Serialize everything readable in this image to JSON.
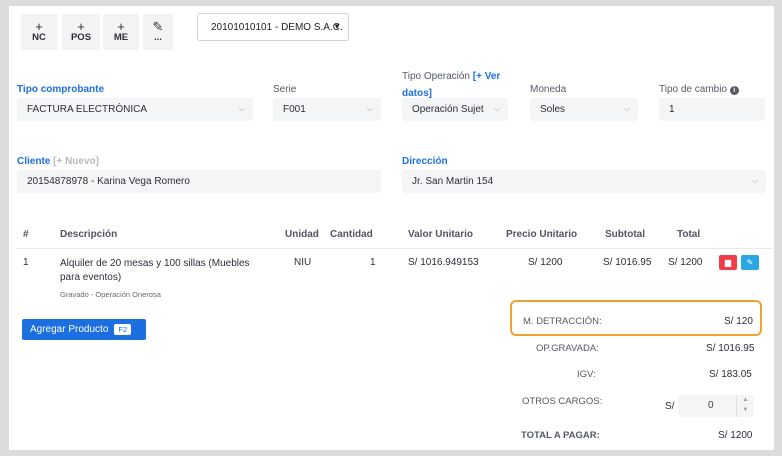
{
  "toolbar": {
    "buttons": [
      {
        "icon": "plus-icon",
        "glyph": "+",
        "label": "NC"
      },
      {
        "icon": "plus-icon",
        "glyph": "+",
        "label": "POS"
      },
      {
        "icon": "plus-icon",
        "glyph": "+",
        "label": "ME"
      },
      {
        "icon": "pencil-icon",
        "glyph": "✎",
        "label": "..."
      }
    ],
    "company": "20101010101 - DEMO S.A.C."
  },
  "form": {
    "tipo_comprobante": {
      "label": "Tipo comprobante",
      "value": "FACTURA ELECTRÓNICA"
    },
    "serie": {
      "label": "Serie",
      "value": "F001"
    },
    "tipo_operacion": {
      "label": "Tipo Operación",
      "link": "[+ Ver datos]",
      "value": "Operación Sujet"
    },
    "moneda": {
      "label": "Moneda",
      "value": "Soles"
    },
    "tipo_cambio": {
      "label": "Tipo de cambio",
      "value": "1"
    },
    "cliente": {
      "label": "Cliente",
      "link": "[+ Nuevo]",
      "value": "20154878978 - Karina Vega Romero"
    },
    "direccion": {
      "label": "Dirección",
      "value": "Jr. San Martin 154"
    }
  },
  "table": {
    "headers": [
      "#",
      "Descripción",
      "Unidad",
      "Cantidad",
      "Valor Unitario",
      "Precio Unitario",
      "Subtotal",
      "Total"
    ],
    "rows": [
      {
        "num": "1",
        "description_line1": "Alquiler de 20 mesas y 100 sillas (Muebles",
        "description_line2": "para eventos)",
        "note": "Gravado - Operación Onerosa",
        "unidad": "NIU",
        "cantidad": "1",
        "valor_unitario": "S/ 1016.949153",
        "precio_unitario": "S/ 1200",
        "subtotal": "S/ 1016.95",
        "total": "S/ 1200"
      }
    ]
  },
  "add_product": {
    "label": "Agregar Producto",
    "shortcut": "F2"
  },
  "summary": {
    "detraccion": {
      "label": "M. DETRACCIÓN:",
      "value": "S/ 120"
    },
    "op_gravada": {
      "label": "OP.GRAVADA:",
      "value": "S/ 1016.95"
    },
    "igv": {
      "label": "IGV:",
      "value": "S/ 183.05"
    },
    "otros_cargos": {
      "label": "OTROS CARGOS:",
      "currency": "S/",
      "value": "0"
    },
    "total_pagar": {
      "label": "TOTAL A PAGAR:",
      "value": "S/ 1200"
    }
  },
  "colors": {
    "accent": "#1d6fe0",
    "danger": "#ef3e4a",
    "info": "#2aa7e4",
    "highlight": "#f0a231"
  }
}
